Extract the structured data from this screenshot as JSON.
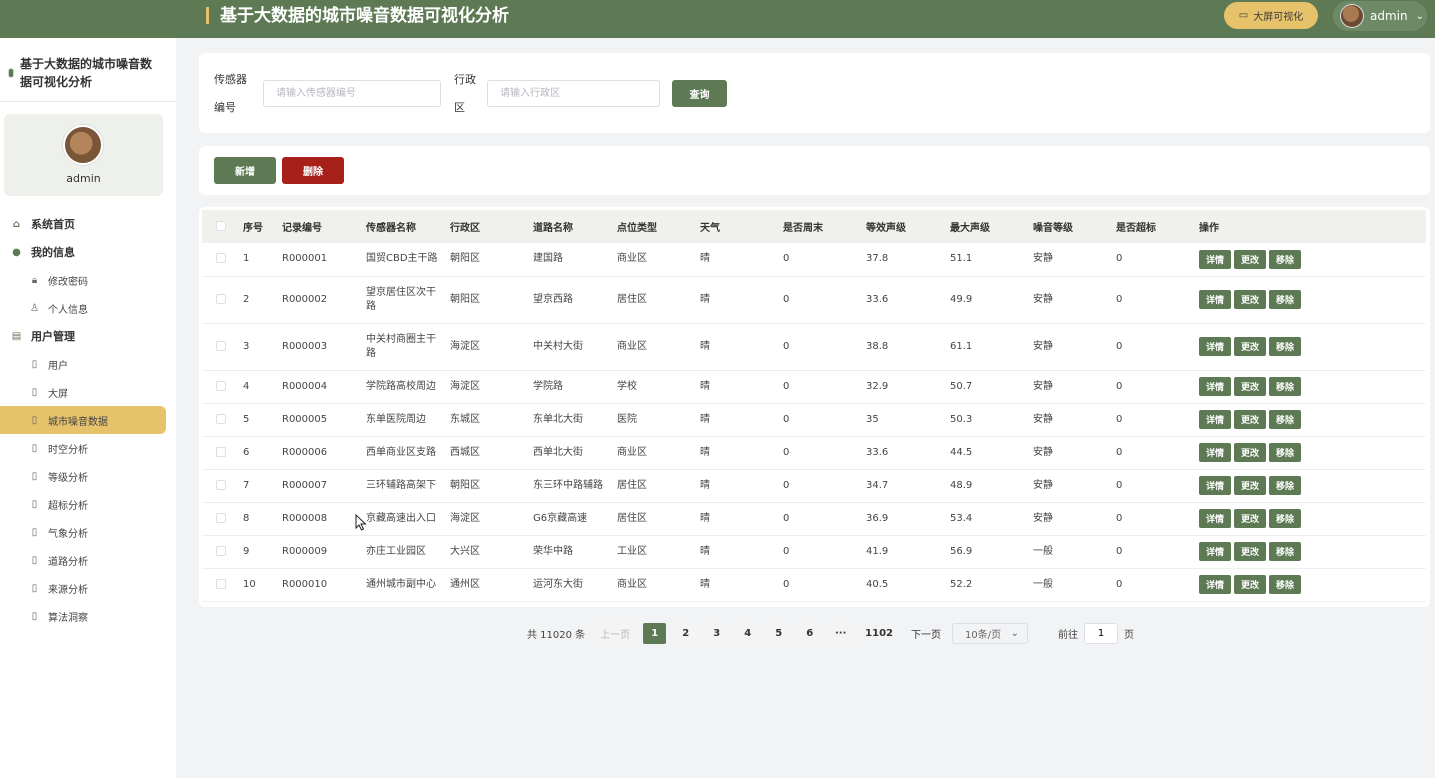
{
  "header": {
    "title": "基于大数据的城市噪音数据可视化分析",
    "screen_button": "大屏可视化",
    "user": "admin"
  },
  "sidebar": {
    "brand": "基于大数据的城市噪音数据可视化分析",
    "profile_name": "admin",
    "groups": [
      {
        "label": "系统首页",
        "icon": "home-icon"
      },
      {
        "label": "我的信息",
        "icon": "user-icon",
        "items": [
          "修改密码",
          "个人信息"
        ]
      },
      {
        "label": "用户管理",
        "icon": "presentation-icon",
        "items": [
          "用户",
          "大屏",
          "城市噪音数据",
          "时空分析",
          "等级分析",
          "超标分析",
          "气象分析",
          "道路分析",
          "来源分析",
          "算法洞察"
        ]
      }
    ],
    "active_item": "城市噪音数据"
  },
  "search": {
    "sensor_label": "传感器编号",
    "sensor_placeholder": "请输入传感器编号",
    "district_label": "行政区",
    "district_placeholder": "请输入行政区",
    "query_button": "查询"
  },
  "actions": {
    "add_button": "新增",
    "delete_button": "删除"
  },
  "table": {
    "columns": [
      "序号",
      "记录编号",
      "传感器名称",
      "行政区",
      "道路名称",
      "点位类型",
      "天气",
      "是否周末",
      "等效声级",
      "最大声级",
      "噪音等级",
      "是否超标",
      "操作"
    ],
    "op_labels": [
      "详情",
      "更改",
      "移除"
    ],
    "rows": [
      [
        "1",
        "R000001",
        "国贸CBD主干路",
        "朝阳区",
        "建国路",
        "商业区",
        "晴",
        "0",
        "37.8",
        "51.1",
        "安静",
        "0"
      ],
      [
        "2",
        "R000002",
        "望京居住区次干路",
        "朝阳区",
        "望京西路",
        "居住区",
        "晴",
        "0",
        "33.6",
        "49.9",
        "安静",
        "0"
      ],
      [
        "3",
        "R000003",
        "中关村商圈主干路",
        "海淀区",
        "中关村大街",
        "商业区",
        "晴",
        "0",
        "38.8",
        "61.1",
        "安静",
        "0"
      ],
      [
        "4",
        "R000004",
        "学院路高校周边",
        "海淀区",
        "学院路",
        "学校",
        "晴",
        "0",
        "32.9",
        "50.7",
        "安静",
        "0"
      ],
      [
        "5",
        "R000005",
        "东单医院周边",
        "东城区",
        "东单北大街",
        "医院",
        "晴",
        "0",
        "35",
        "50.3",
        "安静",
        "0"
      ],
      [
        "6",
        "R000006",
        "西单商业区支路",
        "西城区",
        "西单北大街",
        "商业区",
        "晴",
        "0",
        "33.6",
        "44.5",
        "安静",
        "0"
      ],
      [
        "7",
        "R000007",
        "三环辅路高架下",
        "朝阳区",
        "东三环中路辅路",
        "居住区",
        "晴",
        "0",
        "34.7",
        "48.9",
        "安静",
        "0"
      ],
      [
        "8",
        "R000008",
        "京藏高速出入口",
        "海淀区",
        "G6京藏高速",
        "居住区",
        "晴",
        "0",
        "36.9",
        "53.4",
        "安静",
        "0"
      ],
      [
        "9",
        "R000009",
        "亦庄工业园区",
        "大兴区",
        "荣华中路",
        "工业区",
        "晴",
        "0",
        "41.9",
        "56.9",
        "一般",
        "0"
      ],
      [
        "10",
        "R000010",
        "通州城市副中心",
        "通州区",
        "运河东大街",
        "商业区",
        "晴",
        "0",
        "40.5",
        "52.2",
        "一般",
        "0"
      ]
    ]
  },
  "pagination": {
    "total": "共 11020 条",
    "prev": "上一页",
    "pages": [
      "1",
      "2",
      "3",
      "4",
      "5",
      "6"
    ],
    "ellipsis": "···",
    "last": "1102",
    "next": "下一页",
    "page_size": "10条/页",
    "goto_prefix": "前往",
    "goto_value": "1",
    "goto_suffix": "页"
  },
  "colors": {
    "primary": "#5d7a55",
    "accent": "#e6c26b",
    "danger": "#a7211a"
  }
}
